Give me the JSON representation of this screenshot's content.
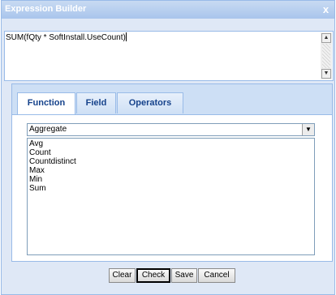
{
  "dialog": {
    "title": "Expression Builder",
    "close_glyph": "x",
    "close_icon": "close-icon"
  },
  "expression": {
    "value": "SUM(fQty * SoftInstall.UseCount)"
  },
  "scrollbar": {
    "up_glyph": "▲",
    "down_glyph": "▼"
  },
  "tabs": [
    {
      "label": "Function",
      "active": true
    },
    {
      "label": "Field",
      "active": false
    },
    {
      "label": "Operators",
      "active": false
    }
  ],
  "function_select": {
    "selected": "Aggregate",
    "arrow_glyph": "▼"
  },
  "functions": [
    "Avg",
    "Count",
    "Countdistinct",
    "Max",
    "Min",
    "Sum"
  ],
  "buttons": {
    "clear": "Clear",
    "check": "Check",
    "save": "Save",
    "cancel": "Cancel"
  },
  "colors": {
    "title_bar": "#a9c5ec",
    "border": "#99bbe8",
    "tab_text": "#15428b"
  }
}
